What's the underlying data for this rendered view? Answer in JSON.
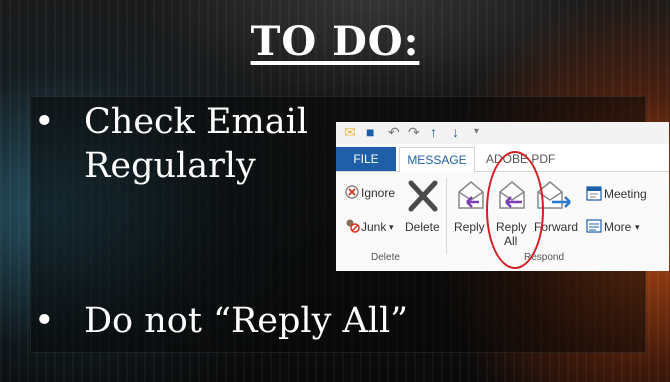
{
  "slide": {
    "title": "TO DO:",
    "bullets": [
      {
        "marker": "•",
        "line1": "Check Email",
        "line2": "Regularly"
      },
      {
        "marker": "•",
        "text": "Do not “Reply All”"
      }
    ]
  },
  "ribbon": {
    "tabs": [
      "FILE",
      "MESSAGE",
      "ADOBE PDF"
    ],
    "delete_group": {
      "ignore": "Ignore",
      "junk": "Junk",
      "junk_arrow": "▾",
      "delete": "Delete",
      "label": "Delete"
    },
    "respond_group": {
      "reply": "Reply",
      "reply_all_1": "Reply",
      "reply_all_2": "All",
      "forward": "Forward",
      "meeting": "Meeting",
      "more": "More",
      "more_arrow": "▾",
      "label": "Respond"
    }
  },
  "colors": {
    "tab_file": "#1f5fa8",
    "highlight_circle": "#d21f27",
    "reply_arrow": "#7a3fb5",
    "forward_arrow": "#2a79d0"
  }
}
